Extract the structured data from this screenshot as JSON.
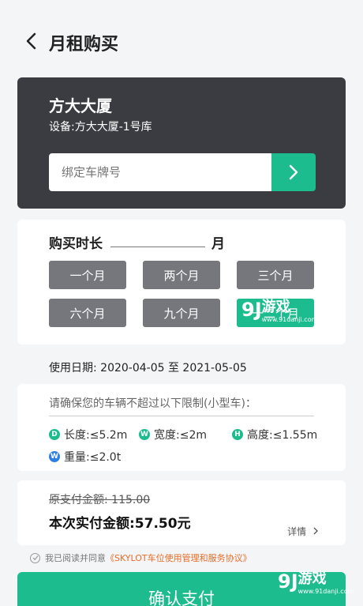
{
  "header": {
    "title": "月租购买"
  },
  "building": {
    "name": "方大大厦",
    "device": "设备:方大大厦-1号库"
  },
  "plate": {
    "placeholder": "绑定车牌号"
  },
  "duration": {
    "label": "购买时长",
    "unit": "月",
    "options": [
      "一个月",
      "两个月",
      "三个月",
      "六个月",
      "九个月",
      "十二个月"
    ],
    "selected_index": 5
  },
  "usage": {
    "date_text": "使用日期: 2020-04-05 至 2021-05-05"
  },
  "limits": {
    "title": "请确保您的车辆不超过以下限制(小型车)：",
    "items": [
      {
        "icon": "D",
        "text": "长度:≤5.2m"
      },
      {
        "icon": "W",
        "text": "宽度:≤2m"
      },
      {
        "icon": "H",
        "text": "高度:≤1.55m"
      },
      {
        "icon": "W",
        "text": "重量:≤2.0t"
      }
    ]
  },
  "payment": {
    "original": "原支付金额: 115.00",
    "actual": "本次实付金额:57.50元",
    "detail": "详情"
  },
  "agreement": {
    "prefix": "我已阅读并同意",
    "link": "《SKYLOT车位使用管理和服务协议》"
  },
  "confirm": {
    "label": "确认支付"
  },
  "watermark": {
    "logo": "9J",
    "text": "游戏",
    "site": "www.91danji.com"
  },
  "colors": {
    "accent": "#1cbc8e",
    "dark_card": "#3b3c42",
    "option": "#76777c",
    "link": "#e86c27"
  }
}
